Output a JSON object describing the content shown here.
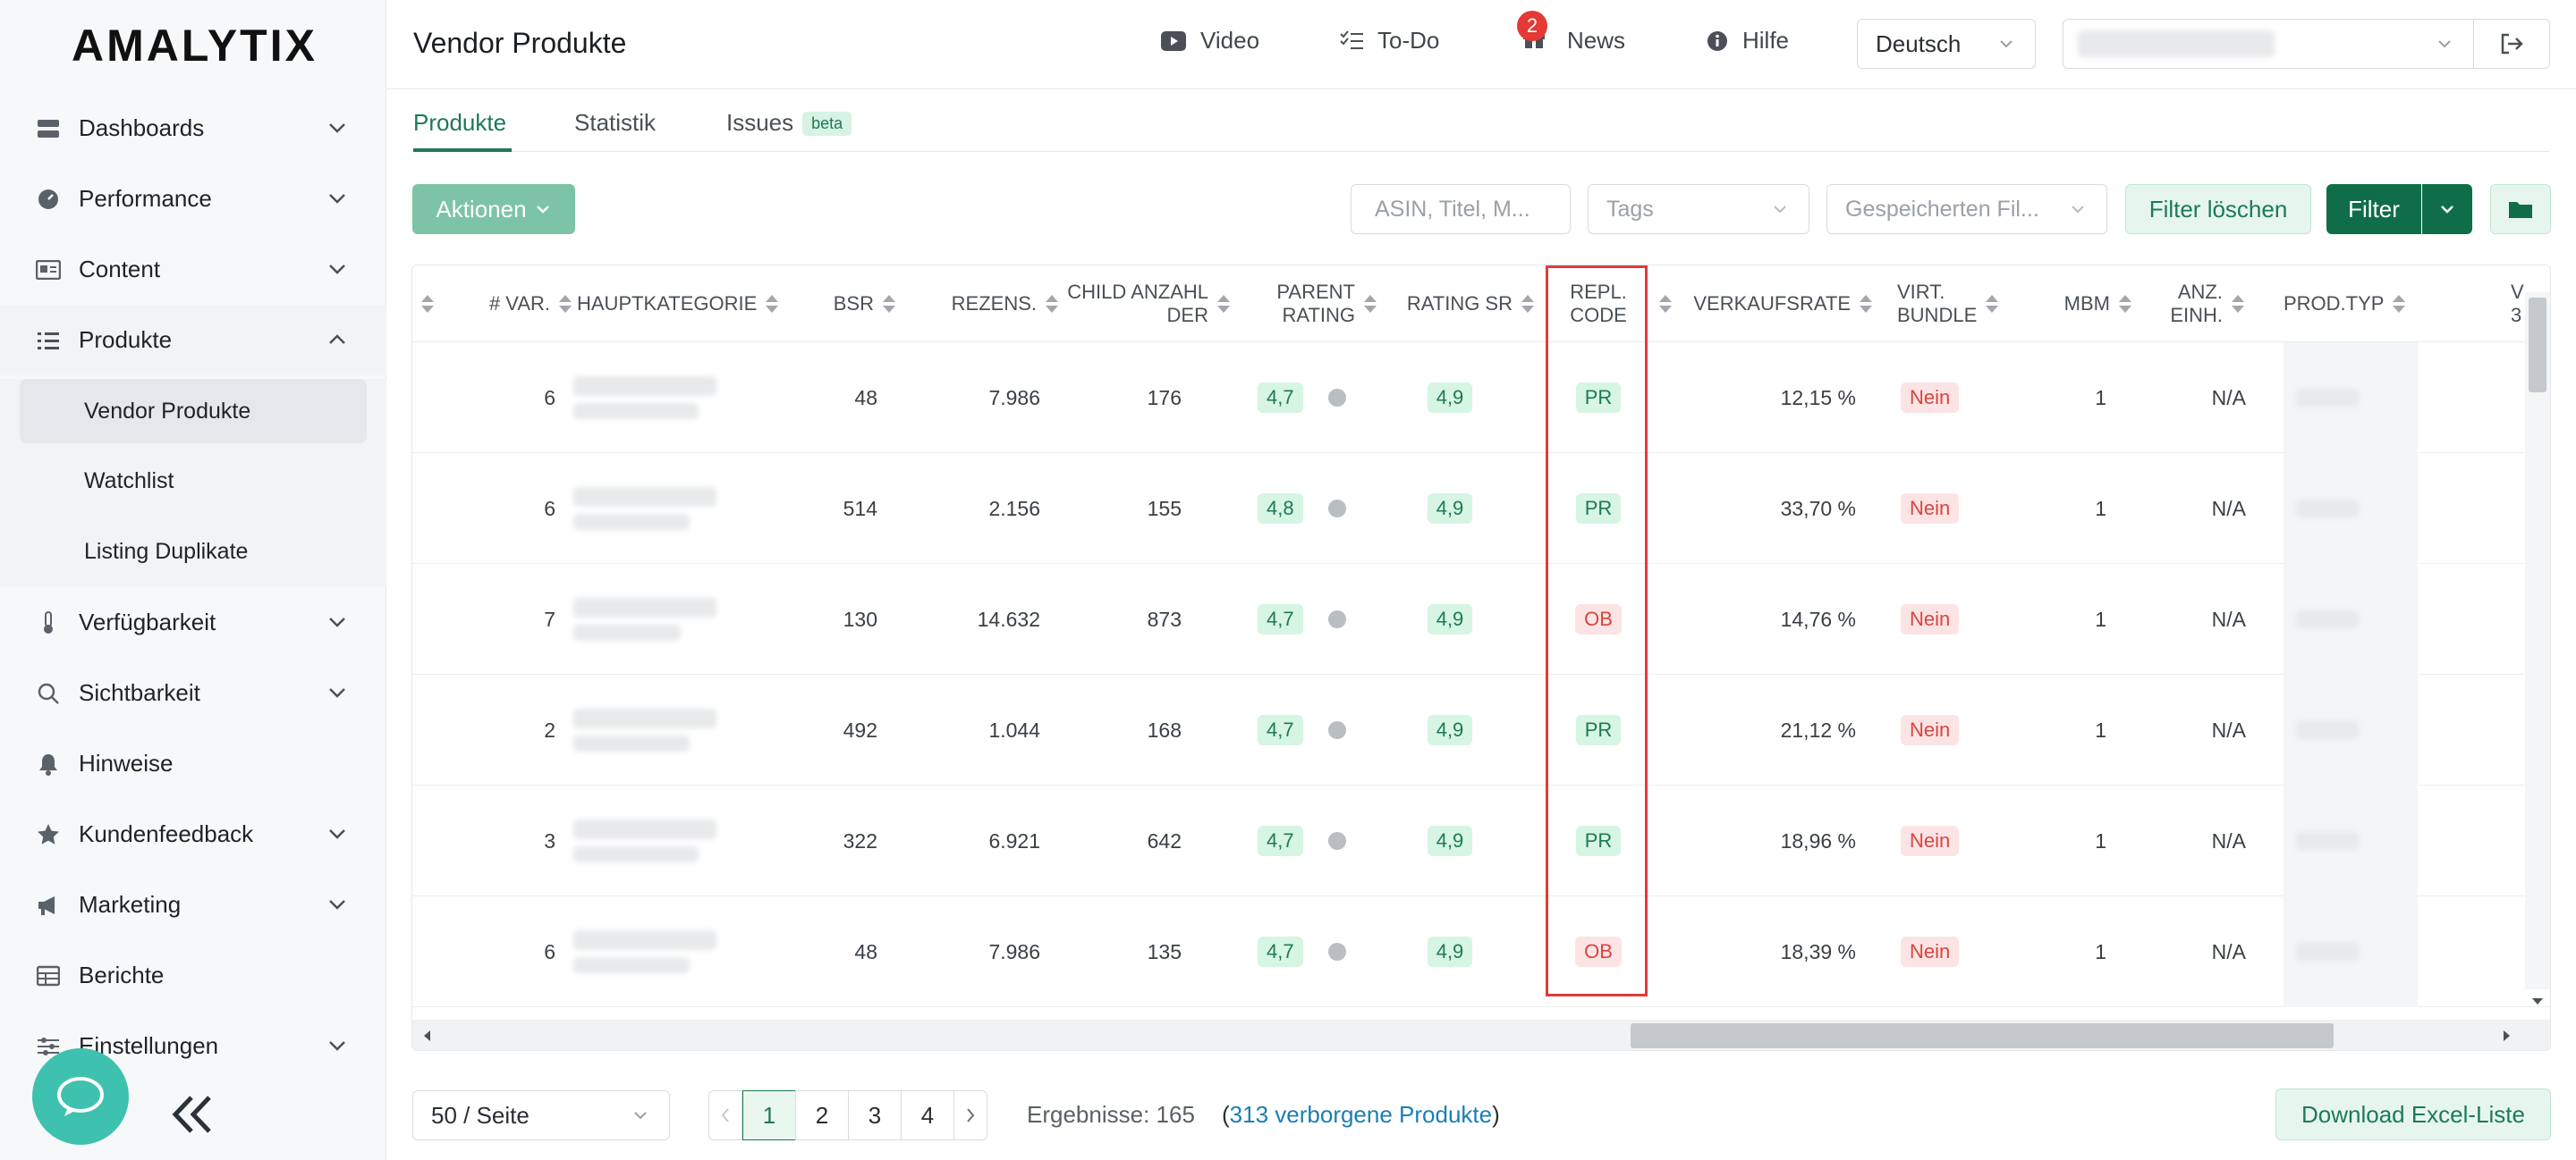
{
  "sidebar": {
    "logo": "AMALYTIX",
    "items": [
      {
        "label": "Dashboards"
      },
      {
        "label": "Performance"
      },
      {
        "label": "Content"
      },
      {
        "label": "Produkte"
      },
      {
        "label": "Verfügbarkeit"
      },
      {
        "label": "Sichtbarkeit"
      },
      {
        "label": "Hinweise"
      },
      {
        "label": "Kundenfeedback"
      },
      {
        "label": "Marketing"
      },
      {
        "label": "Berichte"
      },
      {
        "label": "Einstellungen"
      }
    ],
    "produkte_sub": [
      {
        "label": "Vendor Produkte"
      },
      {
        "label": "Watchlist"
      },
      {
        "label": "Listing Duplikate"
      }
    ]
  },
  "header": {
    "title": "Vendor Produkte",
    "video": "Video",
    "todo": "To-Do",
    "news": "News",
    "news_badge": "2",
    "help": "Hilfe",
    "language": "Deutsch"
  },
  "tabs": {
    "products": "Produkte",
    "stats": "Statistik",
    "issues": "Issues",
    "beta": "beta"
  },
  "toolbar": {
    "actions": "Aktionen",
    "search_placeholder": "ASIN, Titel, M...",
    "tags_placeholder": "Tags",
    "saved_filters_placeholder": "Gespeicherten Fil...",
    "clear_filter": "Filter löschen",
    "filter": "Filter"
  },
  "table": {
    "columns": {
      "var": "# VAR.",
      "category": "HAUPTKATEGORIE",
      "bsr": "BSR",
      "reviews": "REZENS.",
      "child1": "CHILD ANZAHL",
      "child2": "DER",
      "parent1": "PARENT",
      "parent2": "RATING",
      "rating_sr": "RATING SR",
      "repl1": "REPL.",
      "repl2": "CODE",
      "sales": "VERKAUFSRATE",
      "virt1": "VIRT.",
      "virt2": "BUNDLE",
      "mbm": "MBM",
      "anz1": "ANZ.",
      "anz2": "EINH.",
      "prodtyp": "PROD.TYP",
      "next1": "V",
      "next2": "3"
    },
    "rows": [
      {
        "var": "6",
        "bsr": "48",
        "reviews": "7.986",
        "child": "176",
        "parent_rating": "4,7",
        "rating_sr": "4,9",
        "repl_code": "PR",
        "sales_rate": "12,15 %",
        "virt_bundle": "Nein",
        "mbm": "1",
        "anz": "N/A"
      },
      {
        "var": "6",
        "bsr": "514",
        "reviews": "2.156",
        "child": "155",
        "parent_rating": "4,8",
        "rating_sr": "4,9",
        "repl_code": "PR",
        "sales_rate": "33,70 %",
        "virt_bundle": "Nein",
        "mbm": "1",
        "anz": "N/A"
      },
      {
        "var": "7",
        "bsr": "130",
        "reviews": "14.632",
        "child": "873",
        "parent_rating": "4,7",
        "rating_sr": "4,9",
        "repl_code": "OB",
        "sales_rate": "14,76 %",
        "virt_bundle": "Nein",
        "mbm": "1",
        "anz": "N/A"
      },
      {
        "var": "2",
        "bsr": "492",
        "reviews": "1.044",
        "child": "168",
        "parent_rating": "4,7",
        "rating_sr": "4,9",
        "repl_code": "PR",
        "sales_rate": "21,12 %",
        "virt_bundle": "Nein",
        "mbm": "1",
        "anz": "N/A"
      },
      {
        "var": "3",
        "bsr": "322",
        "reviews": "6.921",
        "child": "642",
        "parent_rating": "4,7",
        "rating_sr": "4,9",
        "repl_code": "PR",
        "sales_rate": "18,96 %",
        "virt_bundle": "Nein",
        "mbm": "1",
        "anz": "N/A"
      },
      {
        "var": "6",
        "bsr": "48",
        "reviews": "7.986",
        "child": "135",
        "parent_rating": "4,7",
        "rating_sr": "4,9",
        "repl_code": "OB",
        "sales_rate": "18,39 %",
        "virt_bundle": "Nein",
        "mbm": "1",
        "anz": "N/A"
      }
    ]
  },
  "pagination": {
    "page_size": "50 / Seite",
    "pages": [
      "1",
      "2",
      "3",
      "4"
    ],
    "results": "Ergebnisse: 165",
    "hidden_open": "(",
    "hidden_link": "313 verborgene Produkte",
    "hidden_close": ")",
    "download": "Download Excel-Liste"
  },
  "colors": {
    "brand_green": "#1d7a55",
    "highlight_red": "#e03c3c",
    "chat_teal": "#3fc1b0"
  }
}
